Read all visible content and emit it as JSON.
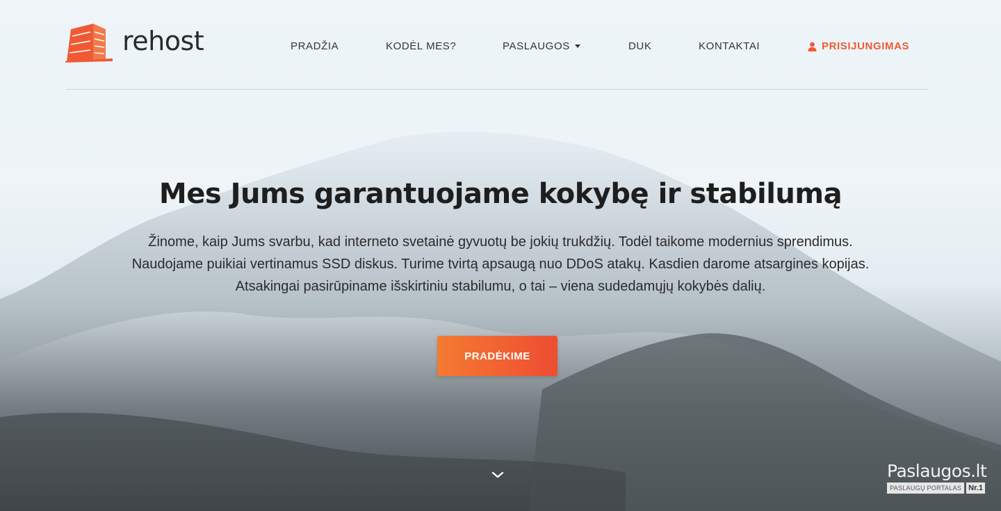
{
  "brand": {
    "name": "rehost",
    "accent_color": "#ef5a35"
  },
  "nav": {
    "items": [
      {
        "label": "PRADŽIA"
      },
      {
        "label": "KODĖL MES?"
      },
      {
        "label": "PASLAUGOS"
      },
      {
        "label": "DUK"
      },
      {
        "label": "KONTAKTAI"
      }
    ],
    "login": {
      "label": "PRISIJUNGIMAS",
      "icon": "user-icon"
    },
    "dropdown_icon": "caret-down-icon"
  },
  "hero": {
    "title": "Mes Jums garantuojame kokybę ir stabilumą",
    "lines": [
      "Žinome, kaip Jums svarbu, kad interneto svetainė gyvuotų be jokių trukdžių. Todėl taikome modernius sprendimus.",
      "Naudojame puikiai vertinamus SSD diskus. Turime tvirtą apsaugą nuo DDoS atakų. Kasdien darome atsargines kopijas.",
      "Atsakingai pasirūpiname išskirtiniu stabilumu, o tai – viena sudedamųjų kokybės dalių."
    ],
    "cta_label": "PRADĖKIME",
    "scroll_icon": "chevron-down-icon"
  },
  "watermark": {
    "title": "Paslaugos.lt",
    "tagline": "PASLAUGŲ PORTALAS",
    "badge": "Nr.1"
  }
}
